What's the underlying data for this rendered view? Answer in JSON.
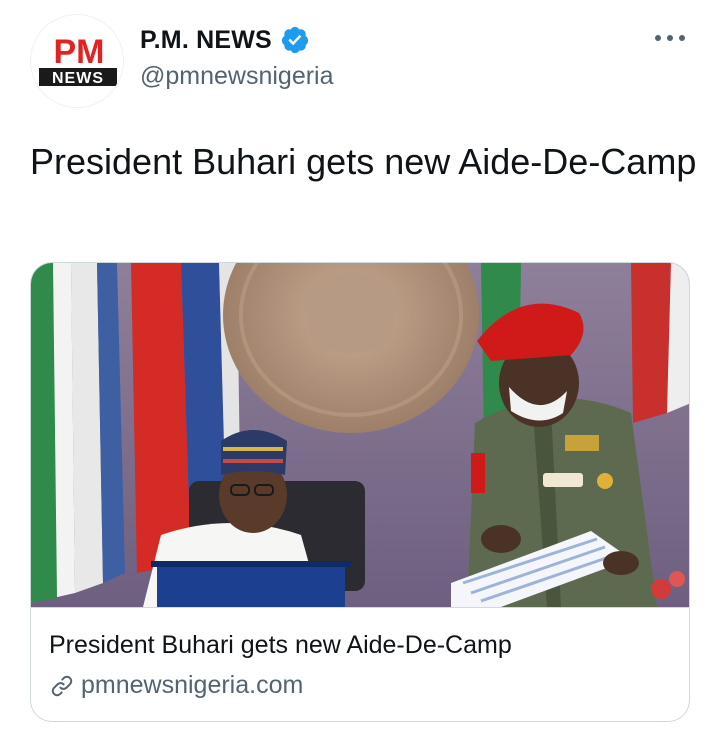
{
  "account": {
    "display_name": "P.M. NEWS",
    "handle": "@pmnewsnigeria",
    "logo_top": "PM",
    "logo_bottom": "NEWS",
    "verified": true
  },
  "tweet": {
    "text": "President Buhari gets new Aide-De-Camp"
  },
  "card": {
    "title": "President Buhari gets new Aide-De-Camp",
    "domain": "pmnewsnigeria.com",
    "image_alt": "President Buhari seated at desk receiving documents from a uniformed military officer"
  },
  "icons": {
    "verified": "verified-badge-icon",
    "more": "more-options-icon",
    "link": "link-icon"
  },
  "colors": {
    "verified_blue": "#1d9bf0",
    "logo_red": "#e02424",
    "text_primary": "#0f1419",
    "text_secondary": "#536471",
    "border": "#cfd9de"
  }
}
